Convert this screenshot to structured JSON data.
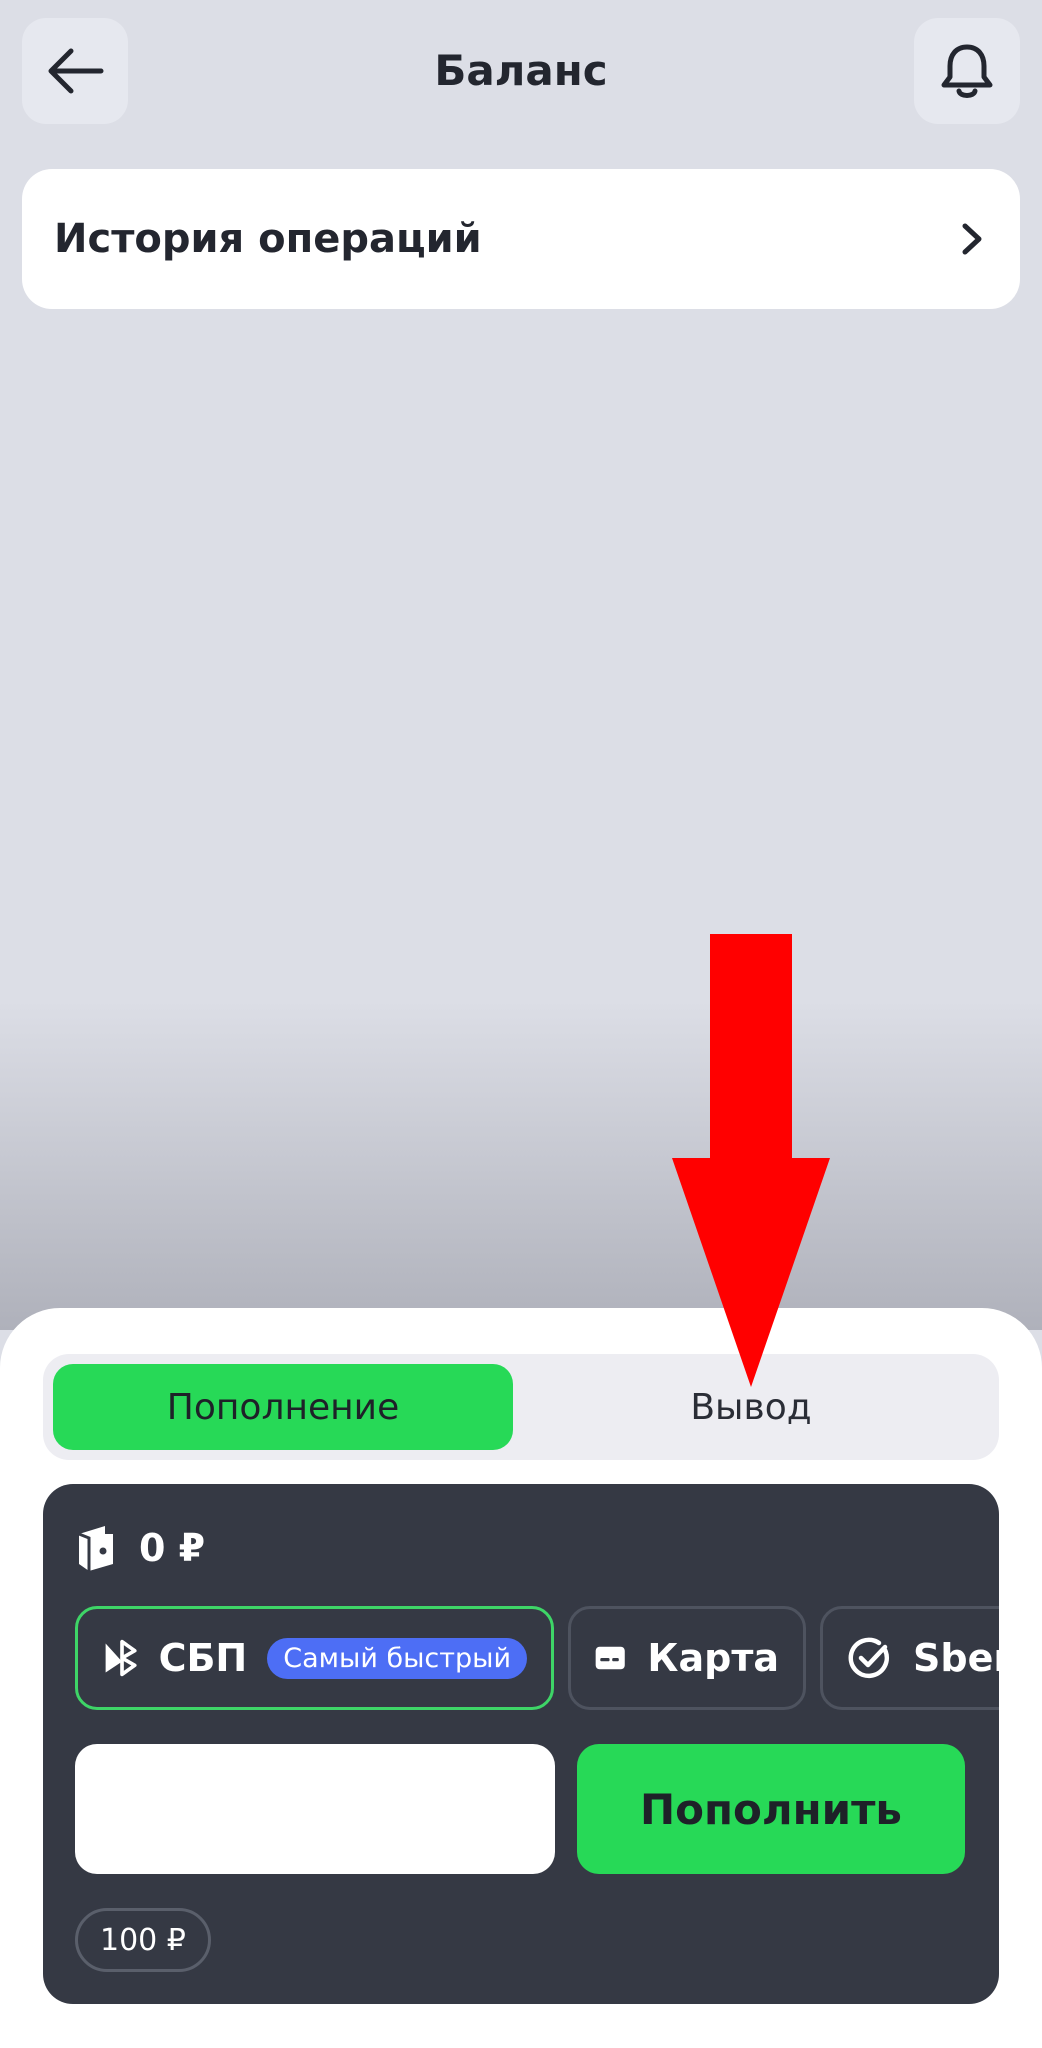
{
  "header": {
    "title": "Баланс",
    "back_icon": "arrow-left-icon",
    "bell_icon": "bell-icon"
  },
  "history": {
    "label": "История операций",
    "chevron_icon": "chevron-right-icon"
  },
  "tabs": {
    "active": "Пополнение",
    "inactive": "Вывод"
  },
  "wallet": {
    "icon": "wallet-icon",
    "balance": "0 ₽"
  },
  "methods": [
    {
      "label": "СБП",
      "badge": "Самый быстрый",
      "icon": "sbp-icon",
      "selected": true
    },
    {
      "label": "Карта",
      "icon": "card-icon",
      "selected": false
    },
    {
      "label": "Sber",
      "icon": "check-circle-icon",
      "selected": false
    }
  ],
  "amount": {
    "value": "",
    "placeholder": ""
  },
  "topup_button": "Пополнить",
  "quick_amount": "100 ₽",
  "colors": {
    "accent_green": "#27d957",
    "dark_card": "#353944",
    "badge_blue": "#4d6ef5",
    "annotation_red": "#ff0000"
  }
}
